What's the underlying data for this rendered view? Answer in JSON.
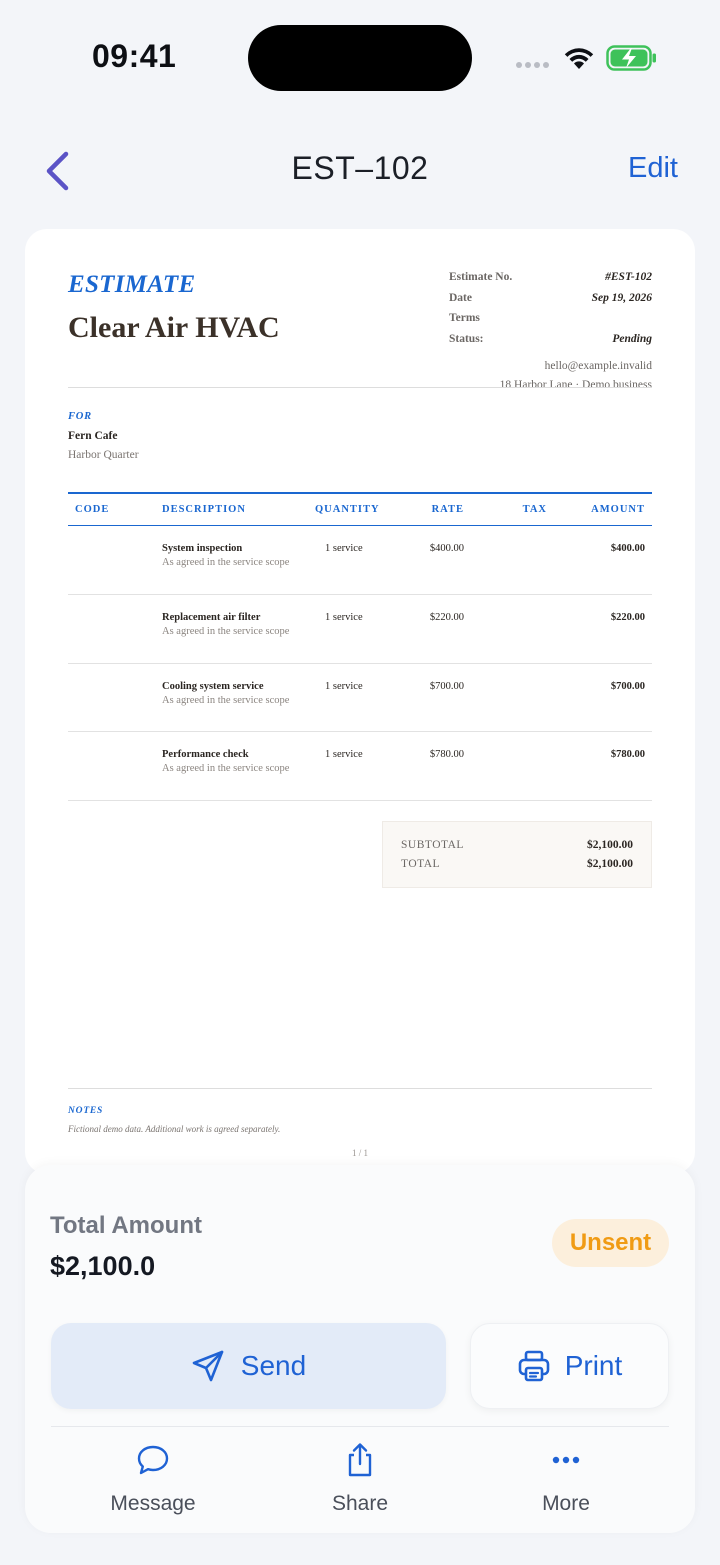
{
  "status_bar": {
    "time": "09:41"
  },
  "nav": {
    "title": "EST–102",
    "edit_label": "Edit"
  },
  "document": {
    "title": "ESTIMATE",
    "business_name": "Clear Air HVAC",
    "meta": [
      {
        "key": "Estimate No.",
        "value": "#EST-102"
      },
      {
        "key": "Date",
        "value": "Sep 19, 2026"
      },
      {
        "key": "Terms",
        "value": ""
      },
      {
        "key": "Status:",
        "value": "Pending"
      }
    ],
    "email": "hello@example.invalid",
    "address": "18 Harbor Lane · Demo business",
    "for_label": "FOR",
    "client_name": "Fern Cafe",
    "client_address": "Harbor Quarter",
    "columns": [
      "CODE",
      "DESCRIPTION",
      "QUANTITY",
      "RATE",
      "TAX",
      "AMOUNT"
    ],
    "items": [
      {
        "name": "System inspection",
        "sub": "As agreed in the service scope",
        "qty": "1 service",
        "rate": "$400.00",
        "amount": "$400.00"
      },
      {
        "name": "Replacement air filter",
        "sub": "As agreed in the service scope",
        "qty": "1 service",
        "rate": "$220.00",
        "amount": "$220.00"
      },
      {
        "name": "Cooling system service",
        "sub": "As agreed in the service scope",
        "qty": "1 service",
        "rate": "$700.00",
        "amount": "$700.00"
      },
      {
        "name": "Performance check",
        "sub": "As agreed in the service scope",
        "qty": "1 service",
        "rate": "$780.00",
        "amount": "$780.00"
      }
    ],
    "subtotal_label": "SUBTOTAL",
    "subtotal_value": "$2,100.00",
    "total_label": "TOTAL",
    "total_value": "$2,100.00",
    "notes_label": "NOTES",
    "notes_text": "Fictional demo data. Additional work is agreed separately.",
    "page_indicator": "1 / 1"
  },
  "panel": {
    "total_amount_label": "Total Amount",
    "total_amount_value": "$2,100.0",
    "status_badge": "Unsent",
    "send_label": "Send",
    "print_label": "Print",
    "actions": {
      "message": "Message",
      "share": "Share",
      "more": "More"
    }
  },
  "colors": {
    "accent": "#1f62d4",
    "badge_text": "#f09b14",
    "badge_bg": "#fcefdc"
  }
}
